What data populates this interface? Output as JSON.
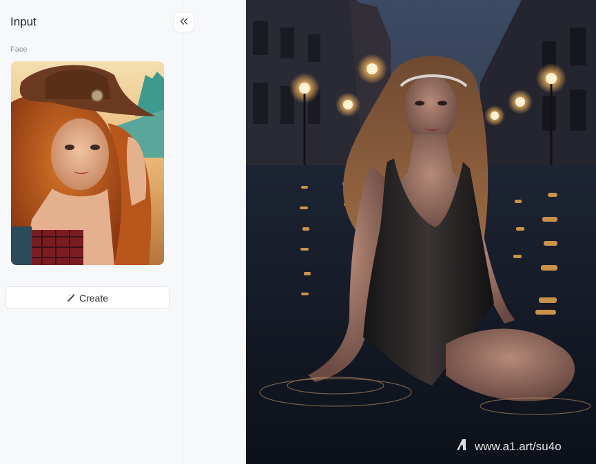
{
  "input_panel": {
    "title": "Input",
    "collapse_icon": "double-chevron-left-icon",
    "face_label": "Face",
    "face_image": "cowgirl-portrait-image",
    "create_icon": "magic-wand-icon",
    "create_label": "Create"
  },
  "output": {
    "image": "woman-sitting-in-flooded-street-at-night",
    "watermark_text": "www.a1.art/su4o",
    "watermark_icon": "a1-logo-icon"
  },
  "colors": {
    "panel_bg": "#f7f8fa",
    "border": "#e3e5e9",
    "text_primary": "#1f2329",
    "text_secondary": "#8a8f98"
  }
}
